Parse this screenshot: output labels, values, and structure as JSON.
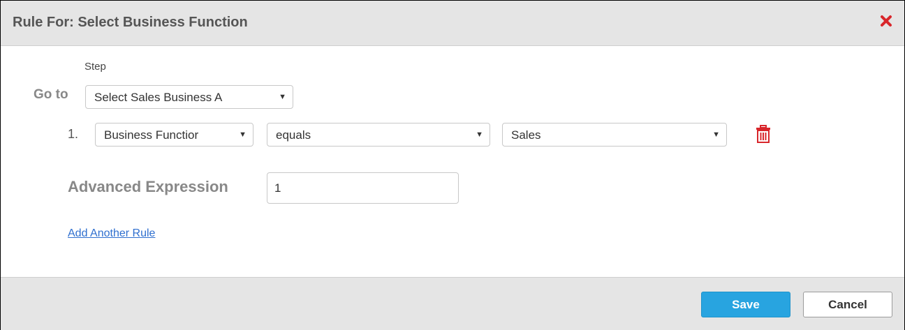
{
  "dialog": {
    "title": "Rule For: Select Business Function",
    "close_icon": "close-icon"
  },
  "step": {
    "label": "Step",
    "goto_label": "Go to",
    "selected": "Select Sales Business A"
  },
  "rules": [
    {
      "number": "1.",
      "field": "Business Functior",
      "operator": "equals",
      "value": "Sales"
    }
  ],
  "advanced": {
    "label": "Advanced Expression",
    "value": "1"
  },
  "add_rule_label": "Add Another Rule",
  "footer": {
    "save_label": "Save",
    "cancel_label": "Cancel"
  },
  "colors": {
    "close": "#d8262b",
    "trash": "#d8262b",
    "save": "#28a4e0",
    "link": "#2f6fcf"
  }
}
